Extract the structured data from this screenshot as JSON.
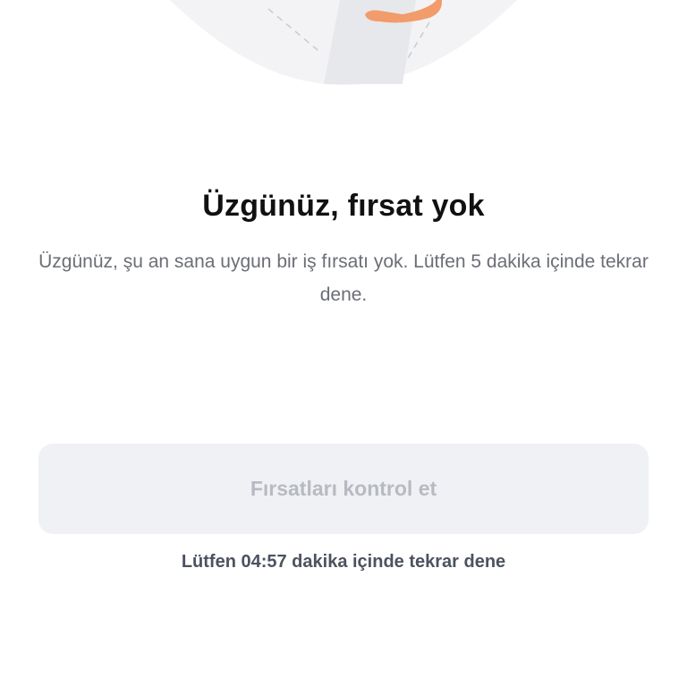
{
  "illustration": {
    "icon": "sad-person-illustration-icon",
    "colors": {
      "circle": "#f3f3f5",
      "body": "#e7e8ec",
      "arm": "#f29b6b",
      "dashes": "#c9cbd1"
    }
  },
  "content": {
    "title": "Üzgünüz, fırsat yok",
    "message": "Üzgünüz, şu an sana uygun bir iş fırsatı yok. Lütfen 5 dakika içinde tekrar dene."
  },
  "action": {
    "button_label": "Fırsatları kontrol et",
    "button_state": "disabled",
    "retry_note": "Lütfen 04:57 dakika içinde tekrar dene"
  },
  "colors": {
    "title": "#111111",
    "message": "#6b6e76",
    "button_bg": "#f0f1f4",
    "button_text": "#b7bac1",
    "retry_note": "#4d5260"
  }
}
